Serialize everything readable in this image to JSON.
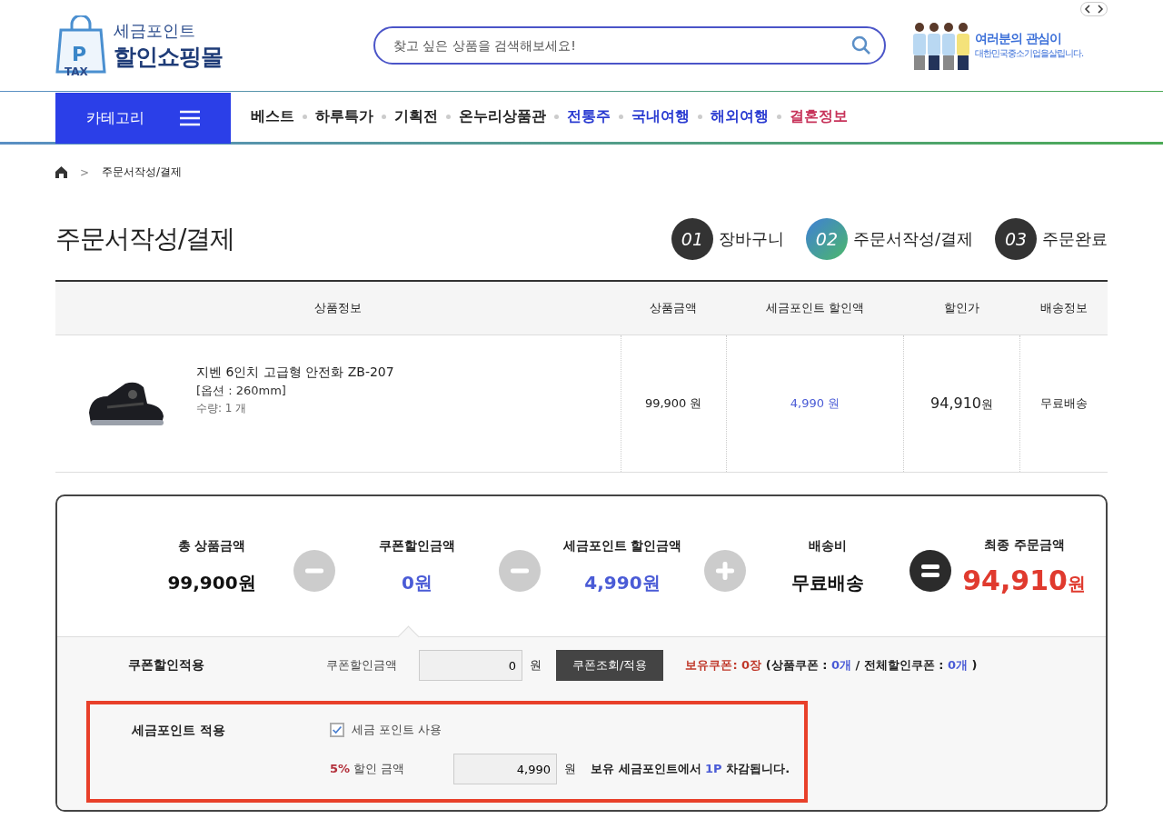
{
  "header": {
    "logo": {
      "badge_letter": "P",
      "badge_text": "TAX",
      "line1": "세금포인트",
      "line2": "할인쇼핑몰"
    },
    "search": {
      "placeholder": "찾고 싶은 상품을 검색해보세요!"
    },
    "promo": {
      "line1": "여러분의 관심이",
      "line2": "대한민국중소기업을살립니다."
    }
  },
  "nav": {
    "category_button": "카테고리",
    "items": [
      {
        "label": "베스트",
        "color": "#222222"
      },
      {
        "label": "하루특가",
        "color": "#222222"
      },
      {
        "label": "기획전",
        "color": "#222222"
      },
      {
        "label": "온누리상품관",
        "color": "#222222"
      },
      {
        "label": "전통주",
        "color": "#2a3bd1"
      },
      {
        "label": "국내여행",
        "color": "#2a3bd1"
      },
      {
        "label": "해외여행",
        "color": "#2a3bd1"
      },
      {
        "label": "결혼정보",
        "color": "#c7335a"
      }
    ]
  },
  "breadcrumb": {
    "separator": ">",
    "current": "주문서작성/결제"
  },
  "page_title": "주문서작성/결제",
  "steps": [
    {
      "number": "01",
      "label": "장바구니",
      "selected": false
    },
    {
      "number": "02",
      "label": "주문서작성/결제",
      "selected": true
    },
    {
      "number": "03",
      "label": "주문완료",
      "selected": false
    }
  ],
  "table": {
    "columns": [
      "상품정보",
      "상품금액",
      "세금포인트 할인액",
      "할인가",
      "배송정보"
    ],
    "rows": [
      {
        "name": "지벤 6인치 고급형 안전화 ZB-207",
        "option": "[옵션 : 260mm]",
        "quantity": "수량: 1 개",
        "price": "99,900 원",
        "point_discount": "4,990 원",
        "discounted": "94,910",
        "discounted_unit": "원",
        "shipping": "무료배송"
      }
    ]
  },
  "summary": {
    "items": [
      {
        "label": "총 상품금액",
        "value": "99,900원",
        "color": "#111111",
        "kind": "minus"
      },
      {
        "label": "쿠폰할인금액",
        "value": "0원",
        "color": "#4a5bd6",
        "kind": "minus"
      },
      {
        "label": "세금포인트 할인금액",
        "value": "4,990원",
        "color": "#4a5bd6",
        "kind": "plus"
      },
      {
        "label": "배송비",
        "value": "무료배송",
        "color": "#111111",
        "kind": "equals"
      }
    ],
    "final": {
      "label": "최종 주문금액",
      "amount": "94,910",
      "unit": "원"
    }
  },
  "coupon": {
    "title": "쿠폰할인적용",
    "field_label": "쿠폰할인금액",
    "value": "0",
    "unit": "원",
    "button": "쿠폰조회/적용",
    "held": [
      {
        "text": "보유쿠폰: 0장",
        "color": "#c0392b"
      },
      {
        "text": " (상품쿠폰 : ",
        "color": "#222222"
      },
      {
        "text": "0개",
        "color": "#4a5bd6"
      },
      {
        "text": " / 전체할인쿠폰 : ",
        "color": "#222222"
      },
      {
        "text": "0개",
        "color": "#4a5bd6"
      },
      {
        "text": " )",
        "color": "#222222"
      }
    ]
  },
  "points": {
    "highlighted": true,
    "title": "세금포인트 적용",
    "checkbox": {
      "label": "세금 포인트 사용",
      "checked": true
    },
    "rate": "5%",
    "rate_label": "할인 금액",
    "value": "4,990",
    "unit": "원",
    "note": [
      {
        "text": "보유 세금포인트에서 ",
        "color": "#222222"
      },
      {
        "text": "1P",
        "color": "#4a5bd6"
      },
      {
        "text": " 차감됩니다.",
        "color": "#222222"
      }
    ]
  }
}
